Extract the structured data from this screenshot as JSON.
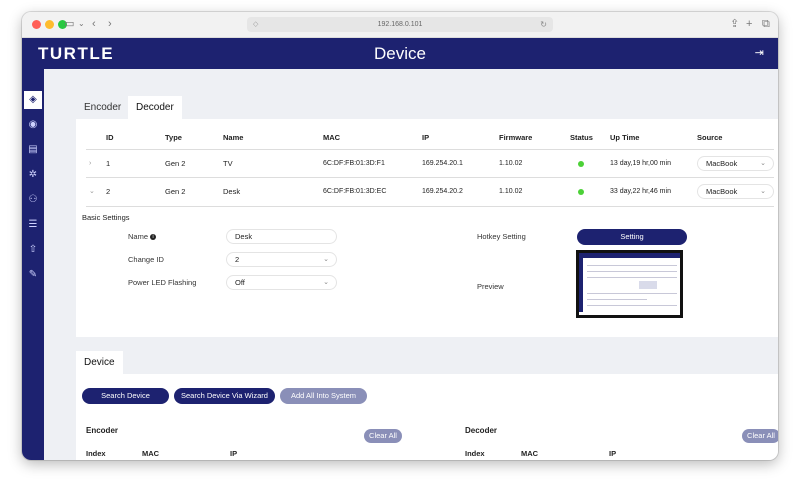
{
  "browser": {
    "url": "192.168.0.101"
  },
  "header": {
    "logo": "TURTLE",
    "title": "Device"
  },
  "tabs": [
    {
      "label": "Encoder"
    },
    {
      "label": "Decoder"
    }
  ],
  "decoder_table": {
    "columns": [
      "ID",
      "Type",
      "Name",
      "MAC",
      "IP",
      "Firmware",
      "Status",
      "Up Time",
      "Source"
    ],
    "rows": [
      {
        "id": "1",
        "type": "Gen 2",
        "name": "TV",
        "mac": "6C:DF:FB:01:3D:F1",
        "ip": "169.254.20.1",
        "firmware": "1.10.02",
        "uptime": "13 day,19 hr,00 min",
        "source": "MacBook"
      },
      {
        "id": "2",
        "type": "Gen 2",
        "name": "Desk",
        "mac": "6C:DF:FB:01:3D:EC",
        "ip": "169.254.20.2",
        "firmware": "1.10.02",
        "uptime": "33 day,22 hr,46 min",
        "source": "MacBook"
      }
    ]
  },
  "basic_settings": {
    "title": "Basic Settings",
    "name_label": "Name",
    "name_value": "Desk",
    "change_id_label": "Change ID",
    "change_id_value": "2",
    "power_led_label": "Power LED Flashing",
    "power_led_value": "Off",
    "hotkey_label": "Hotkey Setting",
    "hotkey_button": "Setting",
    "preview_label": "Preview"
  },
  "device_section": {
    "tab_label": "Device",
    "search_button": "Search Device",
    "wizard_button": "Search Device Via Wizard",
    "add_all_button": "Add All Into System",
    "encoder": {
      "title": "Encoder",
      "clear_button": "Clear All",
      "columns": [
        "Index",
        "MAC",
        "IP"
      ]
    },
    "decoder": {
      "title": "Decoder",
      "clear_button": "Clear All",
      "columns": [
        "Index",
        "MAC",
        "IP"
      ]
    }
  },
  "colors": {
    "brand": "#1d2270",
    "status_online": "#4cd137"
  }
}
